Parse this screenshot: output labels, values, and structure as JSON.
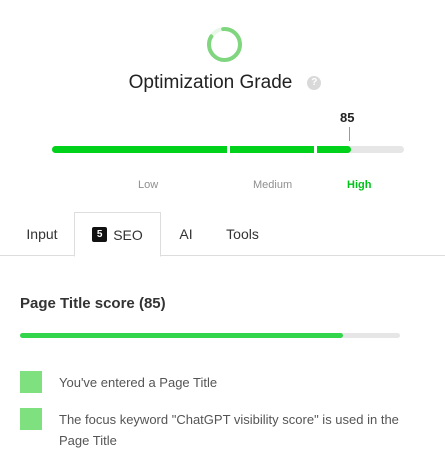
{
  "grade": {
    "title": "Optimization Grade",
    "help_icon": "question-circle-icon",
    "score": 85,
    "score_label": "85",
    "levels": [
      "Low",
      "Medium",
      "High"
    ],
    "active_level": "High",
    "accent": "#00d11a",
    "ring_color": "#7fd67f"
  },
  "tabs": [
    {
      "label": "Input",
      "badge": ""
    },
    {
      "label": "SEO",
      "badge": "5",
      "active": true
    },
    {
      "label": "AI",
      "badge": ""
    },
    {
      "label": "Tools",
      "badge": ""
    }
  ],
  "seo": {
    "heading": "Page Title score (85)",
    "score": 85,
    "checks": [
      {
        "text": "You've entered a Page Title",
        "status": "pass",
        "color": "#7fe07f"
      },
      {
        "text": "The focus keyword \"ChatGPT visibility score\" is used in the Page Title",
        "status": "pass",
        "color": "#7fe07f"
      }
    ]
  }
}
